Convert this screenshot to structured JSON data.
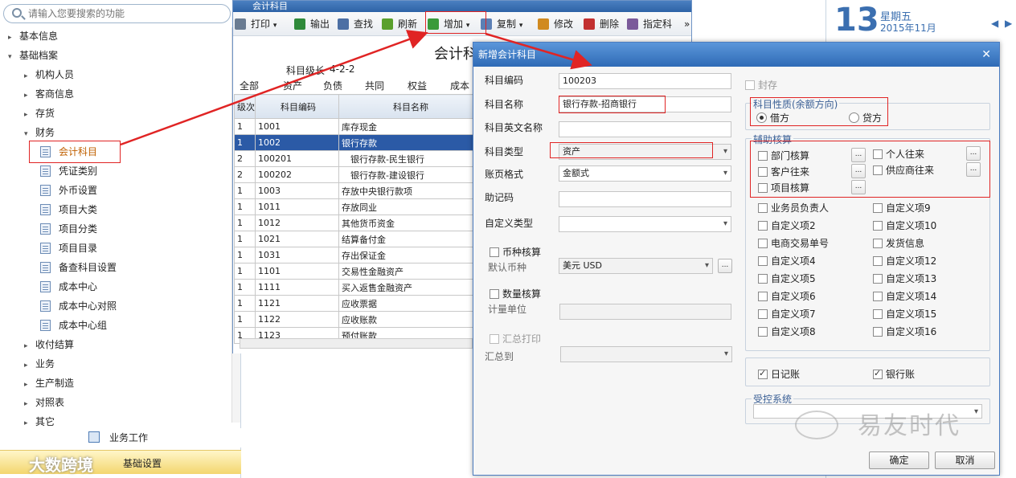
{
  "search": {
    "placeholder": "请输入您要搜索的功能"
  },
  "tree": [
    {
      "label": "基本信息",
      "expanded": false,
      "level": 0
    },
    {
      "label": "基础档案",
      "expanded": true,
      "level": 0
    },
    {
      "label": "机构人员",
      "expanded": false,
      "level": 1
    },
    {
      "label": "客商信息",
      "expanded": false,
      "level": 1
    },
    {
      "label": "存货",
      "expanded": false,
      "level": 1
    },
    {
      "label": "财务",
      "expanded": true,
      "level": 1
    },
    {
      "label": "会计科目",
      "level": 2,
      "selected": true
    },
    {
      "label": "凭证类别",
      "level": 2
    },
    {
      "label": "外币设置",
      "level": 2
    },
    {
      "label": "项目大类",
      "level": 2
    },
    {
      "label": "项目分类",
      "level": 2
    },
    {
      "label": "项目目录",
      "level": 2
    },
    {
      "label": "备查科目设置",
      "level": 2
    },
    {
      "label": "成本中心",
      "level": 2
    },
    {
      "label": "成本中心对照",
      "level": 2
    },
    {
      "label": "成本中心组",
      "level": 2
    },
    {
      "label": "收付结算",
      "expanded": false,
      "level": 1
    },
    {
      "label": "业务",
      "expanded": false,
      "level": 1
    },
    {
      "label": "生产制造",
      "expanded": false,
      "level": 1
    },
    {
      "label": "对照表",
      "expanded": false,
      "level": 1
    },
    {
      "label": "其它",
      "expanded": false,
      "level": 1
    }
  ],
  "bottomnav": {
    "work": "业务工作",
    "settings": "基础设置",
    "watermark_left": "大数跨境"
  },
  "subject_window": {
    "title": "会计科目",
    "heading": "会计科",
    "level_label": "科目级长",
    "level_value": "4-2-2",
    "toolbar": [
      "打印",
      "输出",
      "查找",
      "刷新",
      "增加",
      "复制",
      "修改",
      "删除",
      "指定科"
    ],
    "tabs": [
      "全部",
      "资产",
      "负债",
      "共同",
      "权益",
      "成本"
    ],
    "columns": [
      "级次",
      "科目编码",
      "科目名称"
    ],
    "rows": [
      {
        "level": "1",
        "code": "1001",
        "name": "库存现金"
      },
      {
        "level": "1",
        "code": "1002",
        "name": "银行存款",
        "selected": true
      },
      {
        "level": "2",
        "code": "100201",
        "name": "银行存款-民生银行"
      },
      {
        "level": "2",
        "code": "100202",
        "name": "银行存款-建设银行"
      },
      {
        "level": "1",
        "code": "1003",
        "name": "存放中央银行款项"
      },
      {
        "level": "1",
        "code": "1011",
        "name": "存放同业"
      },
      {
        "level": "1",
        "code": "1012",
        "name": "其他货币资金"
      },
      {
        "level": "1",
        "code": "1021",
        "name": "结算备付金"
      },
      {
        "level": "1",
        "code": "1031",
        "name": "存出保证金"
      },
      {
        "level": "1",
        "code": "1101",
        "name": "交易性金融资产"
      },
      {
        "level": "1",
        "code": "1111",
        "name": "买入返售金融资产"
      },
      {
        "level": "1",
        "code": "1121",
        "name": "应收票据"
      },
      {
        "level": "1",
        "code": "1122",
        "name": "应收账款"
      },
      {
        "level": "1",
        "code": "1123",
        "name": "预付账款"
      }
    ]
  },
  "calendar": {
    "day": "13",
    "weekday": "星期五",
    "yearmonth": "2015年11月"
  },
  "dialog": {
    "title": "新增会计科目",
    "fields": {
      "code_label": "科目编码",
      "code_value": "100203",
      "name_label": "科目名称",
      "name_value": "银行存款-招商银行",
      "en_label": "科目英文名称",
      "en_value": "",
      "type_label": "科目类型",
      "type_value": "资产",
      "page_label": "账页格式",
      "page_value": "金额式",
      "mnemonic_label": "助记码",
      "mnemonic_value": "",
      "custom_label": "自定义类型",
      "custom_value": "",
      "currency_check": "币种核算",
      "currency_label": "默认币种",
      "currency_value": "美元 USD",
      "qty_check": "数量核算",
      "unit_label": "计量单位",
      "unit_value": "",
      "summary_check": "汇总打印",
      "summary_label": "汇总到",
      "summary_value": ""
    },
    "seal": "封存",
    "nature": {
      "title": "科目性质(余额方向)",
      "debit": "借方",
      "credit": "贷方"
    },
    "aux": {
      "title": "辅助核算",
      "items": [
        "部门核算",
        "个人往来",
        "客户往来",
        "供应商往来",
        "项目核算"
      ],
      "more": [
        "业务员负责人",
        "自定义项9",
        "自定义项2",
        "自定义项10",
        "电商交易单号",
        "发货信息",
        "自定义项4",
        "自定义项12",
        "自定义项5",
        "自定义项13",
        "自定义项6",
        "自定义项14",
        "自定义项7",
        "自定义项15",
        "自定义项8",
        "自定义项16"
      ]
    },
    "journal": "日记账",
    "bank": "银行账",
    "controlled": "受控系统",
    "ok": "确定",
    "cancel": "取消",
    "watermark": "易友时代",
    "colors": {
      "accent": "#2f6bb6",
      "highlight": "#e02424"
    }
  }
}
